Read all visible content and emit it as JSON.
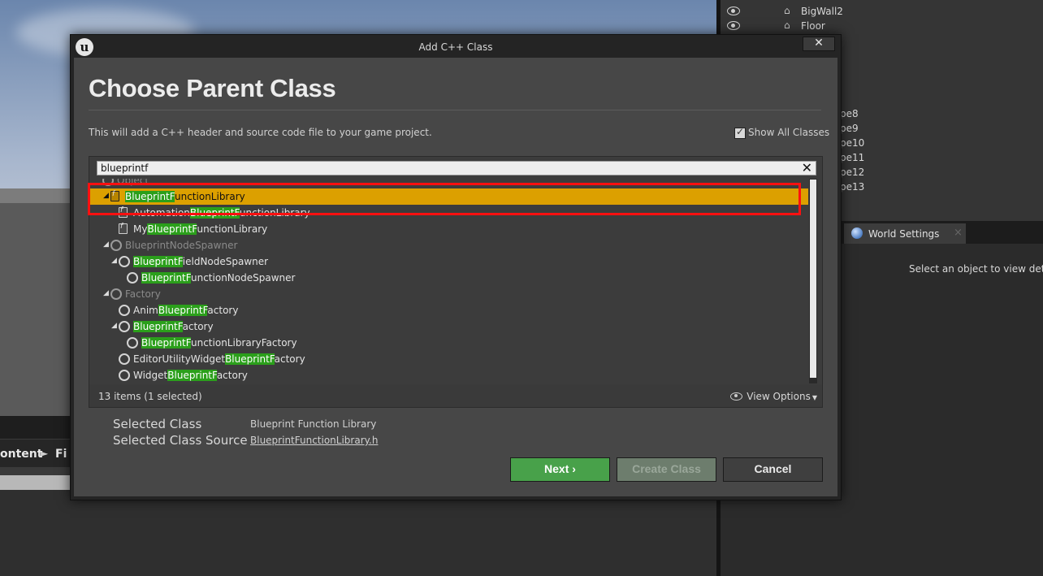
{
  "background": {
    "content_breadcrumb": "ontent",
    "content_breadcrumb_next": "Fi",
    "crumb_arrow": "►",
    "outliner_rows": [
      {
        "name": "BigWall2"
      },
      {
        "name": "Floor"
      },
      {
        "name": "pe8"
      },
      {
        "name": "pe9"
      },
      {
        "name": "pe10"
      },
      {
        "name": "pe11"
      },
      {
        "name": "pe12"
      },
      {
        "name": "pe13"
      }
    ],
    "details_tab": "World Settings",
    "details_tab_close": "×",
    "details_empty": "Select an object to view details."
  },
  "dialog": {
    "title": "Add C++ Class",
    "logo": "u",
    "close_glyph": "✕",
    "heading": "Choose Parent Class",
    "description": "This will add a C++ header and source code file to your game project.",
    "show_all_classes": {
      "label": "Show All Classes",
      "checked": true
    },
    "search": {
      "value": "blueprintf",
      "clear_glyph": "✕"
    },
    "tree": [
      {
        "depth": 0,
        "icon": "circle",
        "expand": "",
        "parts": [
          [
            "Object",
            false
          ]
        ],
        "muted": true,
        "selected": false
      },
      {
        "depth": 1,
        "icon": "function-library",
        "expand": "◢",
        "parts": [
          [
            "BlueprintF",
            true
          ],
          [
            "unctionLibrary",
            false
          ]
        ],
        "muted": false,
        "selected": true
      },
      {
        "depth": 2,
        "icon": "function-library",
        "expand": "",
        "parts": [
          [
            "Automation",
            false
          ],
          [
            "BlueprintF",
            true
          ],
          [
            "unctionLibrary",
            false
          ]
        ],
        "muted": false,
        "selected": false
      },
      {
        "depth": 2,
        "icon": "function-library",
        "expand": "",
        "parts": [
          [
            "My",
            false
          ],
          [
            "BlueprintF",
            true
          ],
          [
            "unctionLibrary",
            false
          ]
        ],
        "muted": false,
        "selected": false
      },
      {
        "depth": 1,
        "icon": "circle",
        "expand": "◢",
        "parts": [
          [
            "BlueprintNodeSpawner",
            false
          ]
        ],
        "muted": true,
        "selected": false
      },
      {
        "depth": 2,
        "icon": "circle",
        "expand": "◢",
        "parts": [
          [
            "BlueprintF",
            true
          ],
          [
            "ieldNodeSpawner",
            false
          ]
        ],
        "muted": false,
        "selected": false
      },
      {
        "depth": 3,
        "icon": "circle",
        "expand": "",
        "parts": [
          [
            "BlueprintF",
            true
          ],
          [
            "unctionNodeSpawner",
            false
          ]
        ],
        "muted": false,
        "selected": false
      },
      {
        "depth": 1,
        "icon": "circle",
        "expand": "◢",
        "parts": [
          [
            "Factory",
            false
          ]
        ],
        "muted": true,
        "selected": false
      },
      {
        "depth": 2,
        "icon": "circle",
        "expand": "",
        "parts": [
          [
            "Anim",
            false
          ],
          [
            "BlueprintF",
            true
          ],
          [
            "actory",
            false
          ]
        ],
        "muted": false,
        "selected": false
      },
      {
        "depth": 2,
        "icon": "circle",
        "expand": "◢",
        "parts": [
          [
            "BlueprintF",
            true
          ],
          [
            "actory",
            false
          ]
        ],
        "muted": false,
        "selected": false
      },
      {
        "depth": 3,
        "icon": "circle",
        "expand": "",
        "parts": [
          [
            "BlueprintF",
            true
          ],
          [
            "unctionLibraryFactory",
            false
          ]
        ],
        "muted": false,
        "selected": false
      },
      {
        "depth": 2,
        "icon": "circle",
        "expand": "",
        "parts": [
          [
            "EditorUtilityWidget",
            false
          ],
          [
            "BlueprintF",
            true
          ],
          [
            "actory",
            false
          ]
        ],
        "muted": false,
        "selected": false
      },
      {
        "depth": 2,
        "icon": "circle",
        "expand": "",
        "parts": [
          [
            "Widget",
            false
          ],
          [
            "BlueprintF",
            true
          ],
          [
            "actory",
            false
          ]
        ],
        "muted": false,
        "selected": false
      }
    ],
    "status": {
      "count": "13 items (1 selected)",
      "view_options": "View Options",
      "view_options_caret": "▼"
    },
    "selected_class_label": "Selected Class",
    "selected_class_value": "Blueprint Function Library",
    "selected_source_label": "Selected Class Source",
    "selected_source_value": "BlueprintFunctionLibrary.h",
    "buttons": {
      "next": "Next",
      "next_arrow": "›",
      "create": "Create Class",
      "cancel": "Cancel"
    },
    "colors": {
      "selection": "#dca000",
      "highlight": "#2b9f1b",
      "next_button": "#48a14a",
      "annotation": "#ff1010"
    }
  }
}
